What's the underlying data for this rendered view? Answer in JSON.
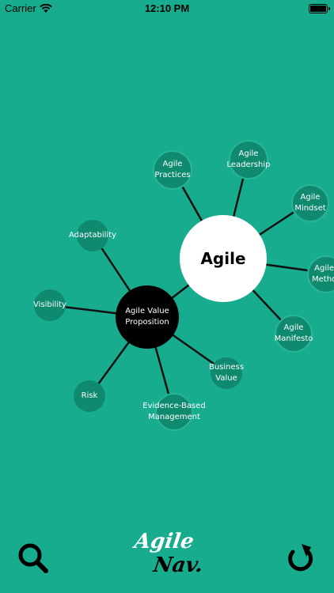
{
  "status_bar": {
    "carrier": "Carrier",
    "time": "12:10 PM"
  },
  "mindmap": {
    "center": "Agile",
    "subcenter": "Agile Value\nProposition",
    "agile_nodes": {
      "practices": "Agile\nPractices",
      "leadership": "Agile\nLeadership",
      "mindset": "Agile\nMindset",
      "methods": "Agile\nMetho",
      "manifesto": "Agile\nManifesto"
    },
    "value_nodes": {
      "adaptability": "Adaptability",
      "visibility": "Visibility",
      "risk": "Risk",
      "evidence_based_management": "Evidence-Based\nManagement",
      "business_value": "Business\nValue"
    }
  },
  "bottom_bar": {
    "logo_line1": "Agile",
    "logo_line2": "Nav."
  },
  "colors": {
    "background": "#17ac8e",
    "node_fill": "#0f8a6e",
    "node_border": "#28b597"
  }
}
